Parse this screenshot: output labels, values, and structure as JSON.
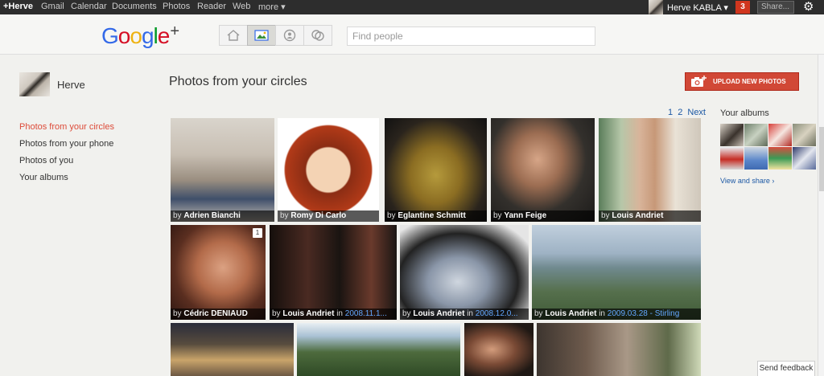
{
  "topbar": {
    "links": [
      "+Herve",
      "Gmail",
      "Calendar",
      "Documents",
      "Photos",
      "Reader",
      "Web",
      "more ▾"
    ],
    "user_name": "Herve KABLA ▾",
    "notifications": "3",
    "share_label": "Share...",
    "gear_icon": "gear-icon"
  },
  "header": {
    "logo": "Google",
    "logo_plus": "+",
    "search_placeholder": "Find people",
    "modes": [
      "home-icon",
      "photos-icon",
      "profile-icon",
      "circles-icon"
    ],
    "active_mode": "photos-icon"
  },
  "sidebar": {
    "profile_name": "Herve",
    "items": [
      {
        "label": "Photos from your circles",
        "active": true
      },
      {
        "label": "Photos from your phone",
        "active": false
      },
      {
        "label": "Photos of you",
        "active": false
      },
      {
        "label": "Your albums",
        "active": false
      }
    ]
  },
  "main": {
    "title": "Photos from your circles",
    "upload_label": "UPLOAD NEW PHOTOS",
    "pager": [
      "1",
      "2",
      "Next"
    ],
    "photos": [
      {
        "by": "by ",
        "author": "Adrien Bianchi",
        "in": "",
        "album": ""
      },
      {
        "by": "by ",
        "author": "Romy Di Carlo",
        "in": "",
        "album": ""
      },
      {
        "by": "by ",
        "author": "Eglantine Schmitt",
        "in": "",
        "album": ""
      },
      {
        "by": "by ",
        "author": "Yann Feige",
        "in": "",
        "album": ""
      },
      {
        "by": "by ",
        "author": "Louis Andriet",
        "in": "",
        "album": ""
      },
      {
        "by": "by ",
        "author": "Cédric DENIAUD",
        "in": "",
        "album": "",
        "comments": "1"
      },
      {
        "by": "by ",
        "author": "Louis Andriet",
        "in": " in ",
        "album": "2008.11.1..."
      },
      {
        "by": "by ",
        "author": "Louis Andriet",
        "in": " in ",
        "album": "2008.12.0..."
      },
      {
        "by": "by ",
        "author": "Louis Andriet",
        "in": " in ",
        "album": "2009.03.28 - Stirling"
      }
    ]
  },
  "albums": {
    "title": "Your albums",
    "view_share": "View and share ›"
  },
  "feedback_label": "Send feedback",
  "colors": {
    "accent_red": "#dd4b39",
    "upload_red": "#d14836",
    "link_blue": "#1c58a4",
    "topbar_bg": "#2d2d2d"
  }
}
